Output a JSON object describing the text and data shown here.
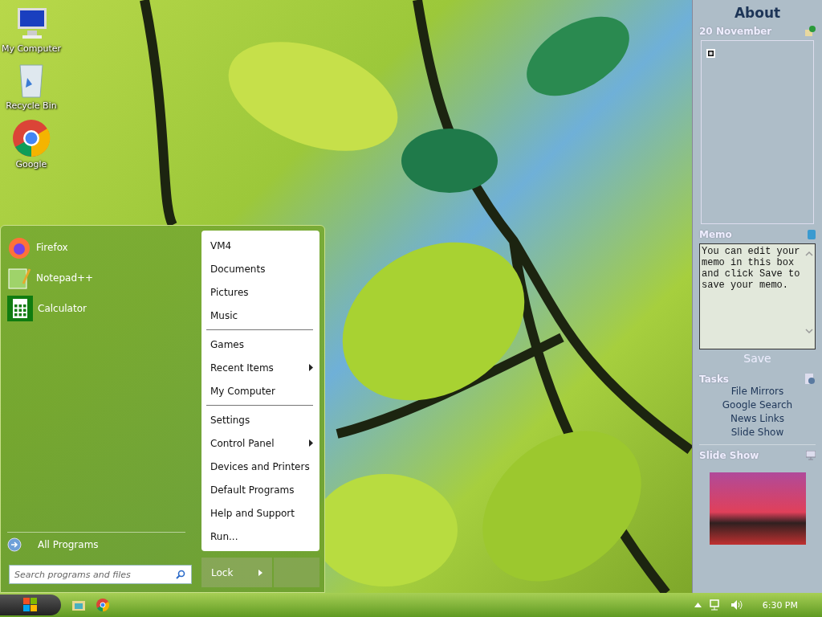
{
  "desktop_icons": [
    {
      "kind": "computer",
      "label": "My Computer"
    },
    {
      "kind": "bin",
      "label": "Recycle Bin"
    },
    {
      "kind": "browser",
      "label": "Google"
    }
  ],
  "start_menu": {
    "pinned": [
      {
        "kind": "firefox",
        "label": "Firefox"
      },
      {
        "kind": "notepad",
        "label": "Notepad++"
      },
      {
        "kind": "calculator",
        "label": "Calculator"
      }
    ],
    "all_programs": "All Programs",
    "search": {
      "placeholder": "Search programs and files"
    },
    "place_groups": [
      [
        {
          "label": "VM4",
          "has_submenu": false
        },
        {
          "label": "Documents",
          "has_submenu": false
        },
        {
          "label": "Pictures",
          "has_submenu": false
        },
        {
          "label": "Music",
          "has_submenu": false
        }
      ],
      [
        {
          "label": "Games",
          "has_submenu": false
        },
        {
          "label": "Recent Items",
          "has_submenu": true
        },
        {
          "label": "My Computer",
          "has_submenu": false
        }
      ],
      [
        {
          "label": "Settings",
          "has_submenu": false
        },
        {
          "label": "Control Panel",
          "has_submenu": true
        },
        {
          "label": "Devices and Printers",
          "has_submenu": false
        },
        {
          "label": "Default Programs",
          "has_submenu": false
        },
        {
          "label": "Help and Support",
          "has_submenu": false
        },
        {
          "label": "Run...",
          "has_submenu": false
        }
      ]
    ],
    "power_button": "Lock"
  },
  "sidebar": {
    "title": "About",
    "date": "20 November",
    "memo": {
      "title": "Memo",
      "text": "You can edit your memo in this box and click Save to save your memo.",
      "save": "Save"
    },
    "tasks": {
      "title": "Tasks",
      "links": [
        "File Mirrors",
        "Google Search",
        "News Links",
        "Slide Show"
      ]
    },
    "slide_show": {
      "title": "Slide Show"
    }
  },
  "taskbar": {
    "clock": "6:30 PM"
  }
}
